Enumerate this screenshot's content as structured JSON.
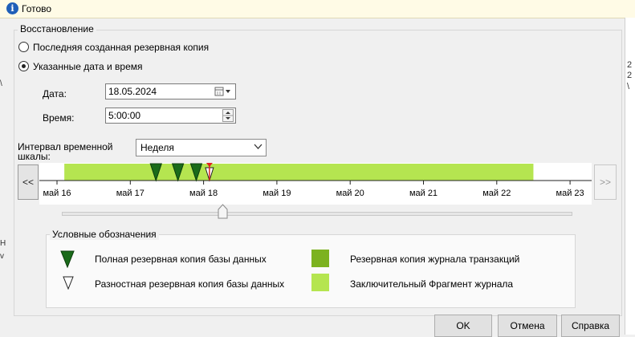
{
  "status": {
    "icon": "info-icon",
    "text": "Готово"
  },
  "restore": {
    "group_title": "Восстановление",
    "option_last": "Последняя созданная резервная копия",
    "option_specific": "Указанные дата и время",
    "date_label": "Дата:",
    "date_value": "18.05.2024",
    "time_label": "Время:",
    "time_value": "5:00:00",
    "interval_label_1": "Интервал временной",
    "interval_label_2": "шкалы:",
    "interval_value": "Неделя"
  },
  "timeline": {
    "prev_label": "<<",
    "next_label": ">>",
    "ticks": [
      "май 16",
      "май 17",
      "май 18",
      "май 19",
      "май 20",
      "май 21",
      "май 22",
      "май 23"
    ],
    "log_range_days": [
      0.1,
      6.5
    ],
    "full_backups_days": [
      1.35,
      1.65,
      1.9
    ],
    "diff_backups_days": [
      2.08
    ],
    "selected_point_days": 2.08,
    "colors": {
      "log_fill": "#b5e550",
      "full_backup": "#1a6b1a",
      "marker": "#e0201e"
    }
  },
  "legend": {
    "title": "Условные обозначения",
    "full": "Полная резервная копия базы данных",
    "diff": "Разностная резервная копия базы данных",
    "tlog": "Резервная копия журнала транзакций",
    "tail": "Заключительный Фрагмент журнала",
    "colors": {
      "tlog": "#7cb21f",
      "tail": "#b5e550"
    }
  },
  "buttons": {
    "ok": "OK",
    "cancel": "Отмена",
    "help": "Справка"
  },
  "side": {
    "right_chars": [
      "2",
      "2",
      "\\"
    ],
    "left_chars": [
      "\\",
      "Н",
      "v"
    ]
  }
}
